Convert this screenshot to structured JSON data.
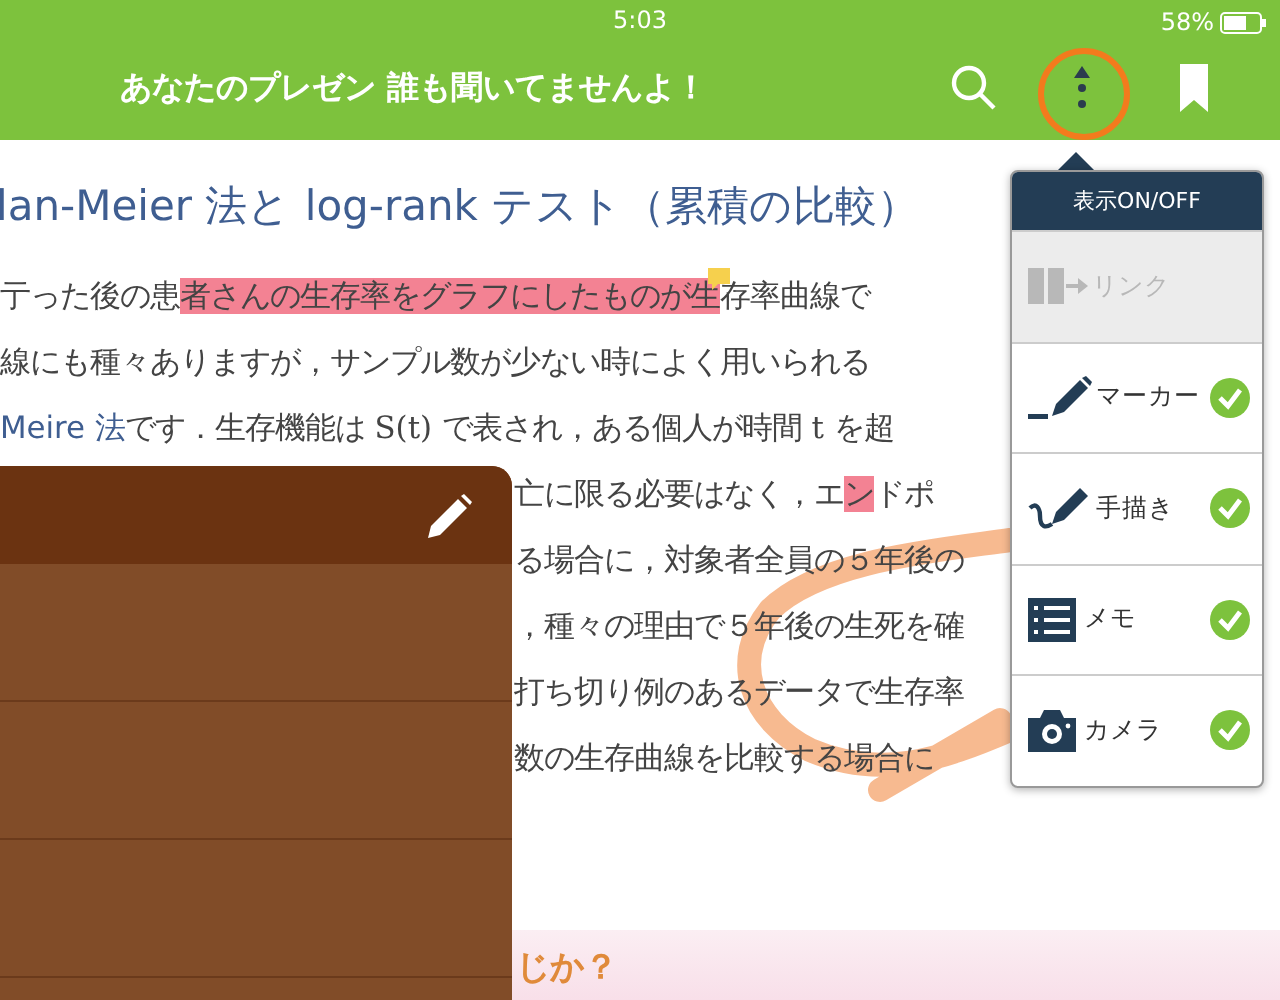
{
  "status_bar": {
    "time": "5:03",
    "battery": "58%"
  },
  "toolbar": {
    "title": "あなたのプレゼン 誰も聞いてませんよ！"
  },
  "article": {
    "heading": "lan-Meier 法と log-rank テスト（累積の比較）",
    "lines": [
      {
        "segments": [
          {
            "text": "亍った後の患",
            "kind": "plain"
          },
          {
            "text": "者さんの生存率をグラフにしたものが生",
            "kind": "highlight",
            "note": true
          },
          {
            "text": "存率曲線で",
            "kind": "plain"
          }
        ]
      },
      {
        "segments": [
          {
            "text": "線にも種々ありますが，サンプル数が少ない時によく用いられる",
            "kind": "plain"
          }
        ]
      },
      {
        "segments": [
          {
            "text": "Meire 法",
            "kind": "link"
          },
          {
            "text": "です．生存機能は S(t) で表され，ある個人が時間 t を超",
            "kind": "plain"
          }
        ]
      }
    ],
    "lines_beside_memo": [
      {
        "segments": [
          {
            "text": "亡に限る必要はなく，エ",
            "kind": "plain"
          },
          {
            "text": "ン",
            "kind": "highlight"
          },
          {
            "text": "ドポ",
            "kind": "plain"
          }
        ]
      },
      {
        "segments": [
          {
            "text": "る場合に，対象者全員の５年後の",
            "kind": "plain"
          }
        ]
      },
      {
        "segments": [
          {
            "text": "，種々の理由で５年後の生死を確",
            "kind": "plain"
          }
        ]
      },
      {
        "segments": [
          {
            "text": "打ち切り例のあるデータで生存率",
            "kind": "plain"
          }
        ]
      },
      {
        "segments": [
          {
            "text": "数の生存曲線を比較する場合に",
            "kind": "plain"
          }
        ]
      }
    ],
    "subheading": "じか？"
  },
  "menu": {
    "title": "表示ON/OFF",
    "items": [
      {
        "kind": "link",
        "label": "リンク",
        "disabled": true,
        "checked": false
      },
      {
        "kind": "marker",
        "label": "マーカー",
        "disabled": false,
        "checked": true
      },
      {
        "kind": "handwriting",
        "label": "手描き",
        "disabled": false,
        "checked": true
      },
      {
        "kind": "memo",
        "label": "メモ",
        "disabled": false,
        "checked": true
      },
      {
        "kind": "camera",
        "label": "カメラ",
        "disabled": false,
        "checked": true
      }
    ]
  }
}
